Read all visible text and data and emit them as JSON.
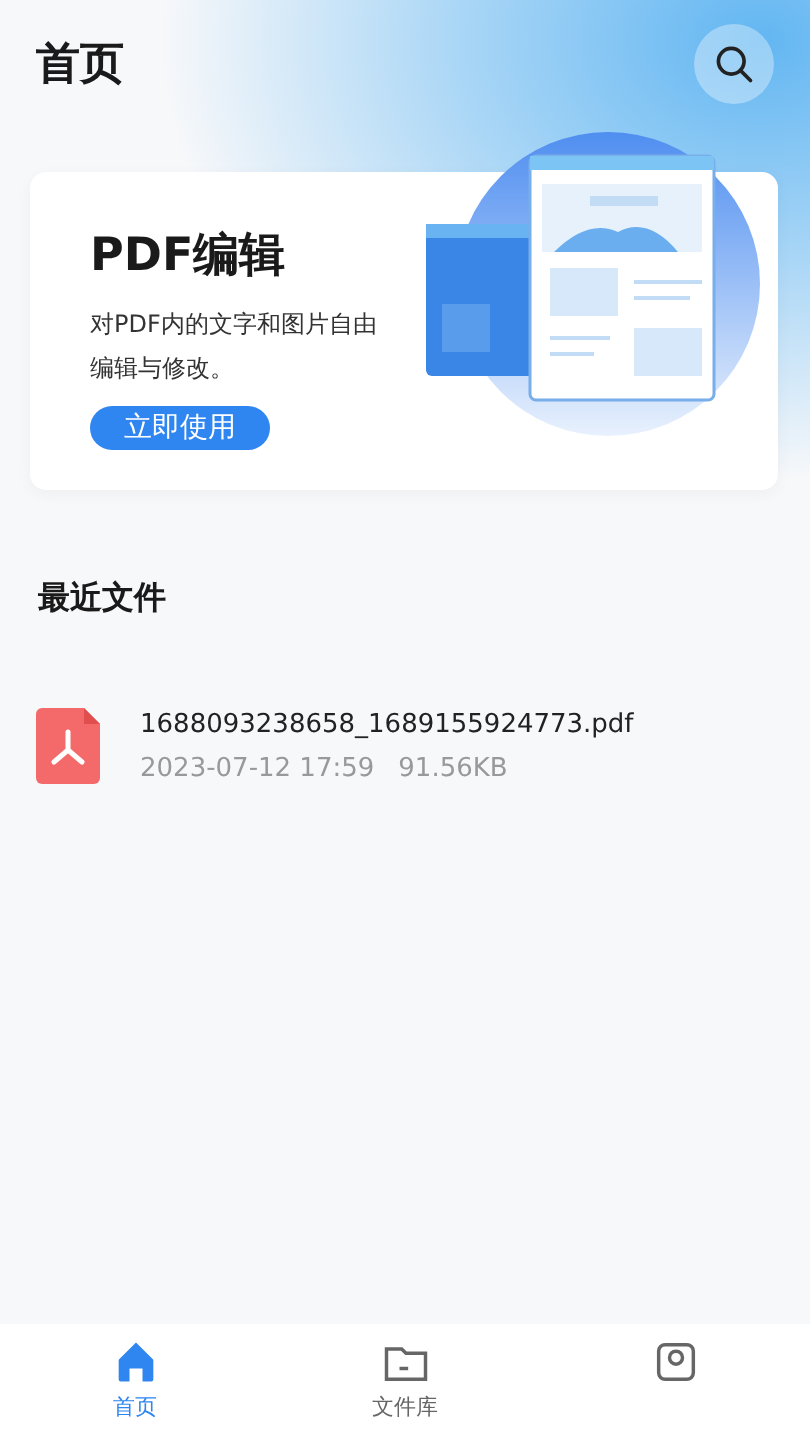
{
  "header": {
    "title": "首页"
  },
  "banner": {
    "title": "PDF编辑",
    "description": "对PDF内的文字和图片自由编辑与修改。",
    "button": "立即使用"
  },
  "recent": {
    "title": "最近文件",
    "files": [
      {
        "name": "1688093238658_1689155924773.pdf",
        "date": "2023-07-12 17:59",
        "size": "91.56KB"
      }
    ]
  },
  "tabs": [
    {
      "kind": "home",
      "label": "首页",
      "selected": true
    },
    {
      "kind": "folder",
      "label": "文件库",
      "selected": false
    },
    {
      "kind": "profile",
      "selected": false
    }
  ]
}
